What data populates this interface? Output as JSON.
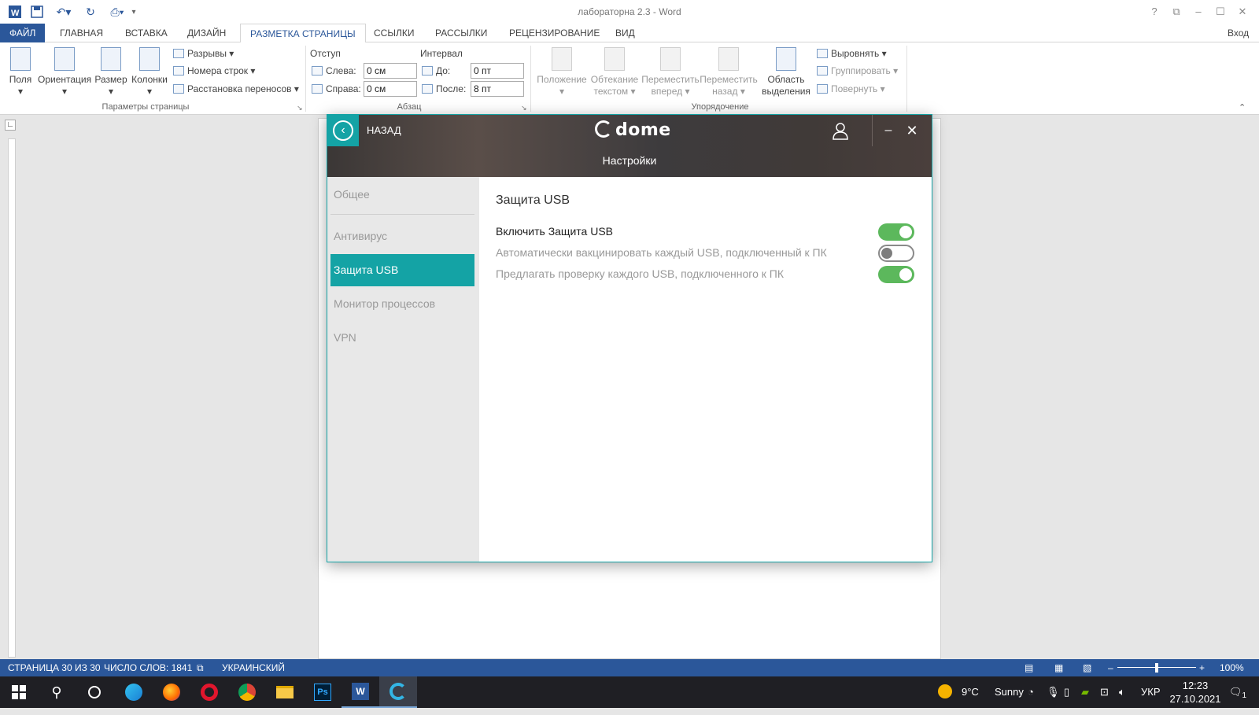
{
  "word": {
    "doc_title": "лабораторна 2.3 - Word",
    "sign_in": "Вход",
    "tabs": [
      "ФАЙЛ",
      "ГЛАВНАЯ",
      "ВСТАВКА",
      "ДИЗАЙН",
      "РАЗМЕТКА СТРАНИЦЫ",
      "ССЫЛКИ",
      "РАССЫЛКИ",
      "РЕЦЕНЗИРОВАНИЕ",
      "ВИД"
    ],
    "active_tab": "РАЗМЕТКА СТРАНИЦЫ",
    "ribbon": {
      "page_setup": {
        "fields": "Поля",
        "orientation": "Ориентация",
        "size": "Размер",
        "columns": "Колонки",
        "breaks": "Разрывы",
        "line_numbers": "Номера строк",
        "hyphenation": "Расстановка переносов",
        "group_label": "Параметры страницы"
      },
      "paragraph": {
        "indent_label": "Отступ",
        "spacing_label": "Интервал",
        "left_label": "Слева:",
        "left_value": "0 см",
        "right_label": "Справа:",
        "right_value": "0 см",
        "before_label": "До:",
        "before_value": "0 пт",
        "after_label": "После:",
        "after_value": "8 пт",
        "group_label": "Абзац"
      },
      "arrange": {
        "position": [
          "Положение",
          ""
        ],
        "wrap": [
          "Обтекание",
          "текстом"
        ],
        "forward": [
          "Переместить",
          "вперед"
        ],
        "backward": [
          "Переместить",
          "назад"
        ],
        "selection": [
          "Область",
          "выделения"
        ],
        "align": "Выровнять",
        "group": "Группировать",
        "rotate": "Повернуть",
        "group_label": "Упорядочение"
      }
    },
    "status": {
      "page": "СТРАНИЦА 30 ИЗ 30",
      "words": "ЧИСЛО СЛОВ: 1841",
      "language": "УКРАИНСКИЙ",
      "zoom": "100%"
    }
  },
  "dome": {
    "back_label": "НАЗАД",
    "logo": "dome",
    "header_title": "Настройки",
    "sidebar": [
      "Общее",
      "Антивирус",
      "Защита USB",
      "Монитор процессов",
      "VPN"
    ],
    "active_item": "Защита USB",
    "content_title": "Защита USB",
    "options": [
      {
        "label": "Включить Защита USB",
        "on": true
      },
      {
        "label": "Автоматически вакцинировать каждый USB, подключенный к ПК",
        "on": false
      },
      {
        "label": "Предлагать проверку каждого USB, подключенного к ПК",
        "on": true
      }
    ],
    "accent_color": "#14a3a5",
    "toggle_on_color": "#5cb85c"
  },
  "taskbar": {
    "weather_temp": "9°C",
    "weather_desc": "Sunny",
    "lang": "УКР",
    "time": "12:23",
    "date": "27.10.2021",
    "notifications": "1"
  }
}
